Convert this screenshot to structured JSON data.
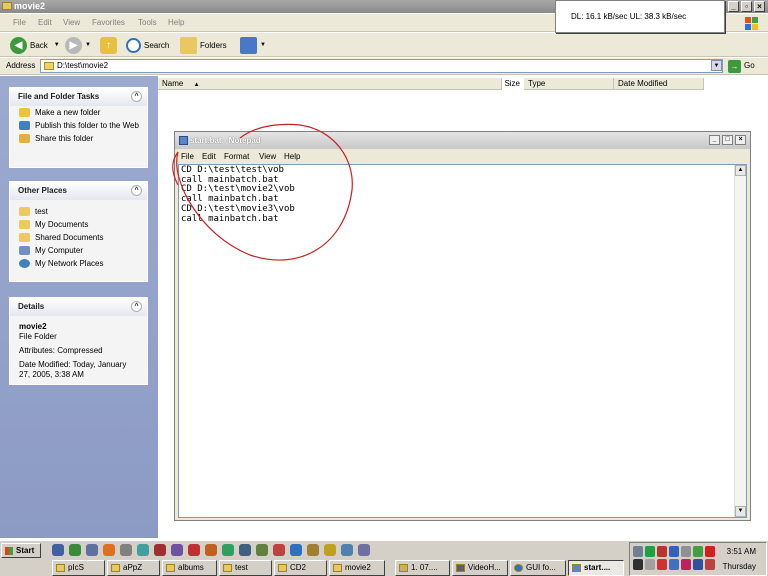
{
  "explorer": {
    "title": "movie2",
    "menu": [
      "File",
      "Edit",
      "View",
      "Favorites",
      "Tools",
      "Help"
    ],
    "toolbar": {
      "back": "Back",
      "search": "Search",
      "folders": "Folders"
    },
    "address": {
      "label": "Address",
      "value": "D:\\test\\movie2",
      "go": "Go"
    },
    "columns": [
      "Name",
      "Size",
      "Type",
      "Date Modified"
    ]
  },
  "bandwidth": {
    "text": "DL: 16.1 kB/sec  UL: 38.3 kB/sec"
  },
  "tasks": {
    "title": "File and Folder Tasks",
    "items": [
      "Make a new folder",
      "Publish this folder to the Web",
      "Share this folder"
    ]
  },
  "places": {
    "title": "Other Places",
    "items": [
      "test",
      "My Documents",
      "Shared Documents",
      "My Computer",
      "My Network Places"
    ]
  },
  "details": {
    "title": "Details",
    "name": "movie2",
    "kind": "File Folder",
    "attributes": "Attributes: Compressed",
    "modified": "Date Modified: Today, January 27, 2005, 3:38 AM"
  },
  "notepad": {
    "title": "start.bat - Notepad",
    "menu": [
      "File",
      "Edit",
      "Format",
      "View",
      "Help"
    ],
    "content": "CD D:\\test\\test\\vob\ncall mainbatch.bat\nCD D:\\test\\movie2\\vob\ncall mainbatch.bat\nCD D:\\test\\movie3\\vob\ncall mainbatch.bat"
  },
  "taskbar": {
    "start": "Start",
    "buttons": [
      "pIcS",
      "aPpZ",
      "albums",
      "test",
      "CD2",
      "movie2",
      "1. 07....",
      "VideoH...",
      "GUI fo...",
      "start...."
    ],
    "time": "3:51 AM",
    "day": "Thursday"
  }
}
